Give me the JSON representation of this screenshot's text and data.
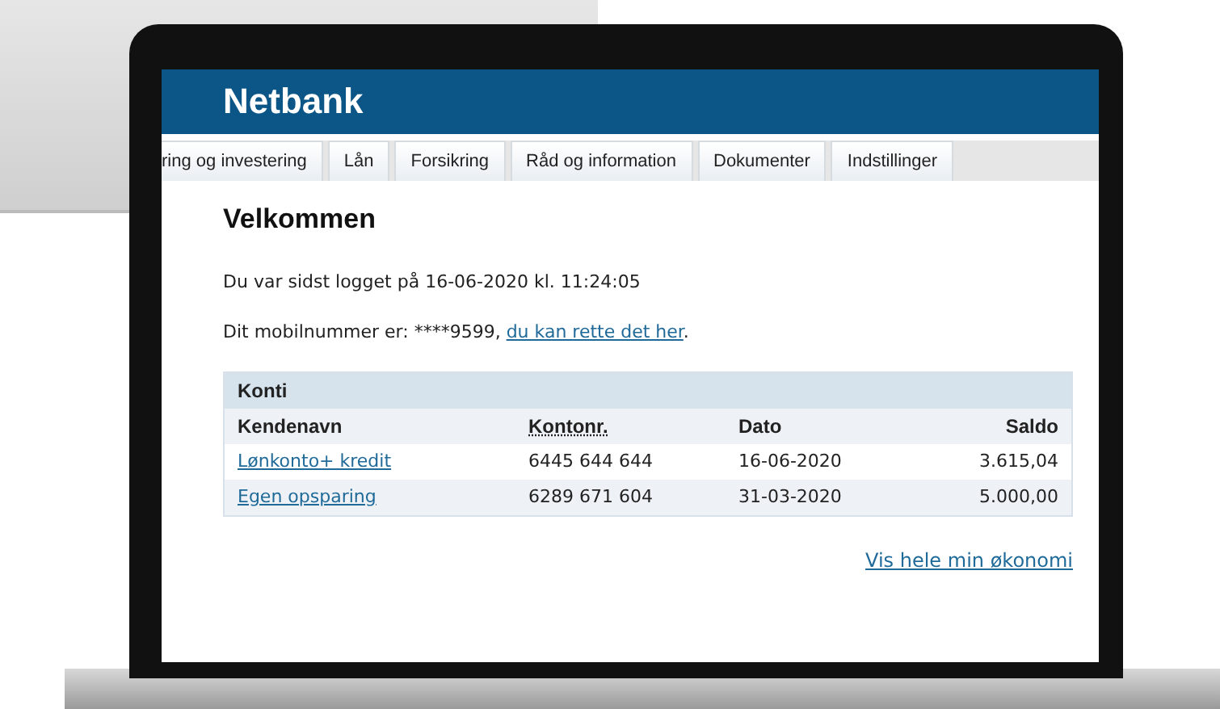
{
  "header": {
    "title": "Netbank"
  },
  "tabs": [
    {
      "label": "ring og investering"
    },
    {
      "label": "Lån"
    },
    {
      "label": "Forsikring"
    },
    {
      "label": "Råd og information"
    },
    {
      "label": "Dokumenter"
    },
    {
      "label": "Indstillinger"
    }
  ],
  "welcome": {
    "heading": "Velkommen",
    "last_login": "Du var sidst logget på 16-06-2020 kl. 11:24:05",
    "mobile_text": "Dit mobilnummer er: ****9599, ",
    "mobile_link": "du kan rette det her",
    "mobile_suffix": "."
  },
  "accounts": {
    "title": "Konti",
    "columns": [
      "Kendenavn",
      "Kontonr.",
      "Dato",
      "Saldo"
    ],
    "rows": [
      {
        "name": "Lønkonto+ kredit",
        "number": "6445 644 644",
        "date": "16-06-2020",
        "balance": "3.615,04"
      },
      {
        "name": "Egen opsparing",
        "number": "6289 671 604",
        "date": "31-03-2020",
        "balance": "5.000,00"
      }
    ],
    "footer_link": "Vis hele min økonomi"
  }
}
